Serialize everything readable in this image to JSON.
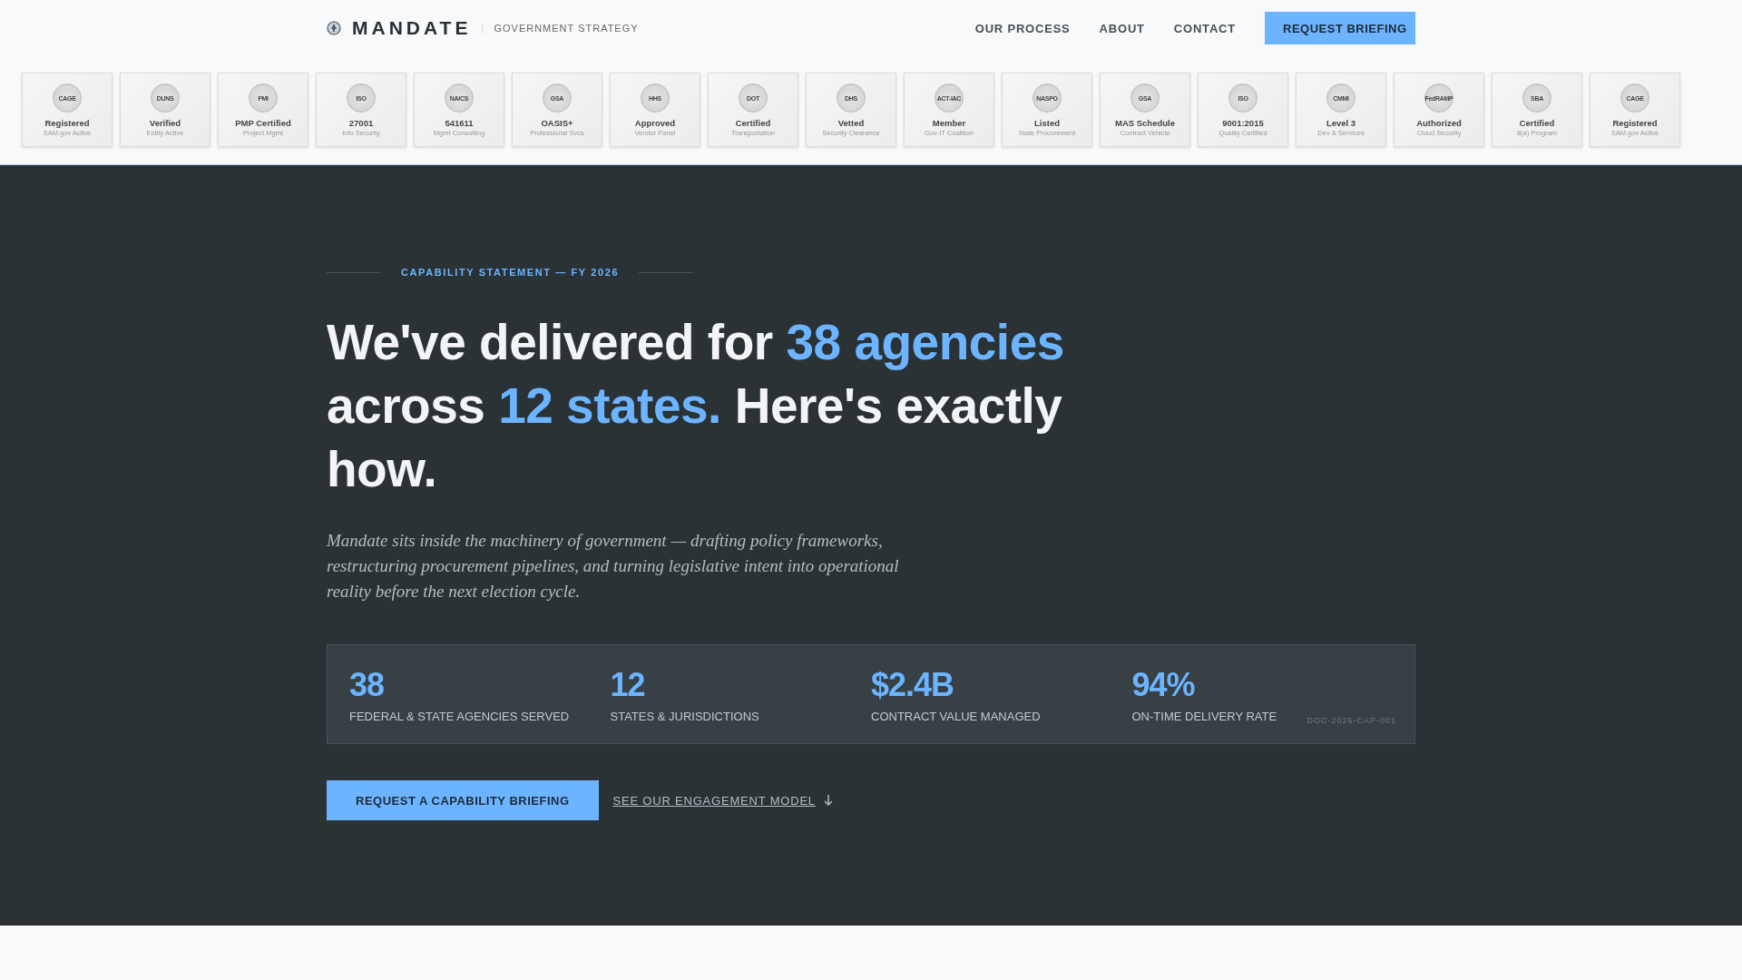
{
  "header": {
    "brand": "MANDATE",
    "tagline": "GOVERNMENT STRATEGY",
    "nav": [
      {
        "label": "OUR PROCESS"
      },
      {
        "label": "ABOUT"
      },
      {
        "label": "CONTACT"
      }
    ],
    "cta": "REQUEST BRIEFING"
  },
  "credentials": [
    {
      "seal": "CAGE",
      "title": "Registered",
      "subtitle": "SAM.gov Active"
    },
    {
      "seal": "DUNS",
      "title": "Verified",
      "subtitle": "Entity Active"
    },
    {
      "seal": "PMI",
      "title": "PMP Certified",
      "subtitle": "Project Mgmt"
    },
    {
      "seal": "ISO",
      "title": "27001",
      "subtitle": "Info Security"
    },
    {
      "seal": "NAICS",
      "title": "541611",
      "subtitle": "Mgmt Consulting"
    },
    {
      "seal": "GSA",
      "title": "OASIS+",
      "subtitle": "Professional Svcs"
    },
    {
      "seal": "HHS",
      "title": "Approved",
      "subtitle": "Vendor Panel"
    },
    {
      "seal": "DOT",
      "title": "Certified",
      "subtitle": "Transportation"
    },
    {
      "seal": "DHS",
      "title": "Vetted",
      "subtitle": "Security Clearance"
    },
    {
      "seal": "ACT-IAC",
      "title": "Member",
      "subtitle": "Gov-IT Coalition"
    },
    {
      "seal": "NASPO",
      "title": "Listed",
      "subtitle": "State Procurement"
    },
    {
      "seal": "GSA",
      "title": "MAS Schedule",
      "subtitle": "Contract Vehicle"
    },
    {
      "seal": "ISO",
      "title": "9001:2015",
      "subtitle": "Quality Certified"
    },
    {
      "seal": "CMMI",
      "title": "Level 3",
      "subtitle": "Dev & Services"
    },
    {
      "seal": "FedRAMP",
      "title": "Authorized",
      "subtitle": "Cloud Security"
    },
    {
      "seal": "SBA",
      "title": "Certified",
      "subtitle": "8(a) Program"
    },
    {
      "seal": "CAGE",
      "title": "Registered",
      "subtitle": "SAM.gov Active"
    }
  ],
  "hero": {
    "eyebrow": "CAPABILITY STATEMENT — FY 2026",
    "headline": [
      {
        "text": "We've delivered for ",
        "highlight": false
      },
      {
        "text": "38 agencies",
        "highlight": true
      },
      {
        "text": " across ",
        "highlight": false
      },
      {
        "text": "12 states.",
        "highlight": true
      },
      {
        "text": " Here's exactly how.",
        "highlight": false
      }
    ],
    "lead": "Mandate sits inside the machinery of government — drafting policy frameworks, restructuring procurement pipelines, and turning legislative intent into operational reality before the next election cycle.",
    "stats": [
      {
        "value": "38",
        "label": "FEDERAL & STATE AGENCIES SERVED"
      },
      {
        "value": "12",
        "label": "STATES & JURISDICTIONS"
      },
      {
        "value": "$2.4B",
        "label": "CONTRACT VALUE MANAGED"
      },
      {
        "value": "94%",
        "label": "ON-TIME DELIVERY RATE"
      }
    ],
    "doc_id": "DOC-2026-CAP-001",
    "primary_action": "REQUEST A CAPABILITY BRIEFING",
    "secondary_action": "SEE OUR ENGAGEMENT MODEL"
  }
}
